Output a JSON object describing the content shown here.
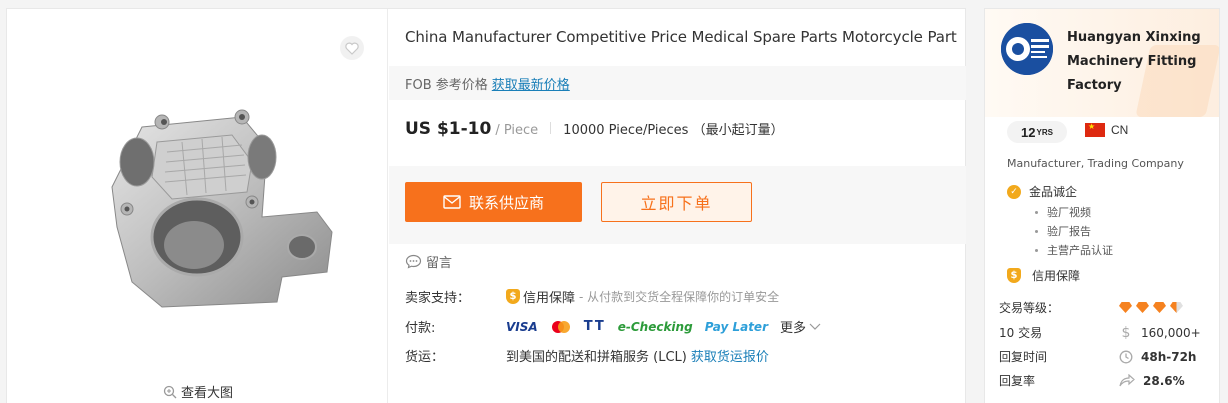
{
  "product": {
    "title": "China Manufacturer Competitive Price Medical Spare Parts Motorcycle Part",
    "fob_label": "FOB 参考价格",
    "fob_link": "获取最新价格",
    "price": "US $1-10",
    "unit": "/ Piece",
    "moq": "10000 Piece/Pieces （最小起订量）",
    "contact_button": "联系供应商",
    "order_button": "立即下单",
    "message": "留言",
    "zoom_label": "查看大图"
  },
  "details": {
    "seller_support_label": "卖家支持：",
    "trade_assurance": "信用保障",
    "trade_assurance_desc": "- 从付款到交货全程保障你的订单安全",
    "payment_label": "付款:",
    "payment_methods": [
      "VISA",
      "TT",
      "e-Checking",
      "Pay Later"
    ],
    "payment_more": "更多",
    "shipping_label": "货运：",
    "shipping_text": "到美国的配送和拼箱服务 (LCL)",
    "shipping_link": "获取货运报价"
  },
  "supplier": {
    "name": "Huangyan Xinxing Machinery Fitting Factory",
    "years": "12",
    "years_unit": "YRS",
    "country": "CN",
    "business_type": "Manufacturer, Trading Company",
    "gold_label": "金品诚企",
    "gold_items": [
      "验厂视频",
      "验厂报告",
      "主营产品认证"
    ],
    "trade_assurance": "信用保障",
    "stats": [
      {
        "label": "交易等级：",
        "value": ""
      },
      {
        "label": "10 交易",
        "value": "160,000+"
      },
      {
        "label": "回复时间",
        "value": "48h-72h"
      },
      {
        "label": "回复率",
        "value": "28.6%"
      }
    ],
    "trade_level_diamonds": 3.5
  },
  "colors": {
    "accent": "#f7711c",
    "link": "#1a7fb8",
    "gold": "#f2a91c"
  }
}
